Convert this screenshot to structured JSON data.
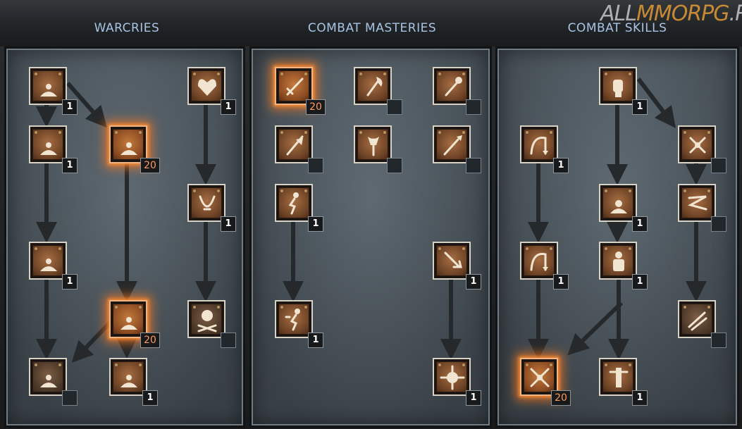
{
  "tabs": [
    {
      "label": "WARCRIES"
    },
    {
      "label": "COMBAT MASTERIES"
    },
    {
      "label": "COMBAT SKILLS"
    }
  ],
  "watermark": {
    "part1": "ALL",
    "part2": "MMORPG",
    "part3": ".RU"
  },
  "colors": {
    "tab_text": "#a9c4e3",
    "badge_max": "#ff9a56",
    "glow": "#ff7a1e",
    "watermark_accent": "#e39a35"
  },
  "nodes": [
    {
      "id": "w1",
      "icon": "howl-icon",
      "level": "1"
    },
    {
      "id": "w2",
      "icon": "find-potion-icon",
      "level": "1"
    },
    {
      "id": "w3",
      "icon": "taunt-icon",
      "level": "20"
    },
    {
      "id": "w4",
      "icon": "shout-icon",
      "level": "1"
    },
    {
      "id": "w5",
      "icon": "find-item-icon",
      "level": "20"
    },
    {
      "id": "w6",
      "icon": "battle-cry-icon",
      "level": ""
    },
    {
      "id": "w7",
      "icon": "battle-orders-icon",
      "level": "1"
    },
    {
      "id": "w8",
      "icon": "grim-ward-icon",
      "level": "1"
    },
    {
      "id": "w9",
      "icon": "battle-command-icon",
      "level": "1"
    },
    {
      "id": "w10",
      "icon": "war-cry-icon",
      "level": ""
    },
    {
      "id": "m1",
      "icon": "sword-mastery-icon",
      "level": "20"
    },
    {
      "id": "m2",
      "icon": "axe-mastery-icon",
      "level": ""
    },
    {
      "id": "m3",
      "icon": "mace-mastery-icon",
      "level": ""
    },
    {
      "id": "m4",
      "icon": "pole-arm-mastery-icon",
      "level": ""
    },
    {
      "id": "m5",
      "icon": "throwing-mastery-icon",
      "level": ""
    },
    {
      "id": "m6",
      "icon": "spear-mastery-icon",
      "level": ""
    },
    {
      "id": "m7",
      "icon": "increased-stamina-icon",
      "level": "1"
    },
    {
      "id": "m8",
      "icon": "iron-skin-icon",
      "level": "1"
    },
    {
      "id": "m9",
      "icon": "increased-speed-icon",
      "level": "1"
    },
    {
      "id": "m10",
      "icon": "natural-resistance-icon",
      "level": "1"
    },
    {
      "id": "s1",
      "icon": "bash-icon",
      "level": "1"
    },
    {
      "id": "s2",
      "icon": "leap-icon",
      "level": "1"
    },
    {
      "id": "s3",
      "icon": "double-swing-icon",
      "level": ""
    },
    {
      "id": "s4",
      "icon": "stun-icon",
      "level": "1"
    },
    {
      "id": "s5",
      "icon": "double-throw-icon",
      "level": ""
    },
    {
      "id": "s6",
      "icon": "leap-attack-icon",
      "level": "1"
    },
    {
      "id": "s7",
      "icon": "concentrate-icon",
      "level": "1"
    },
    {
      "id": "s8",
      "icon": "frenzy-icon",
      "level": ""
    },
    {
      "id": "s9",
      "icon": "whirlwind-icon",
      "level": "20"
    },
    {
      "id": "s10",
      "icon": "berserk-icon",
      "level": "1"
    }
  ]
}
